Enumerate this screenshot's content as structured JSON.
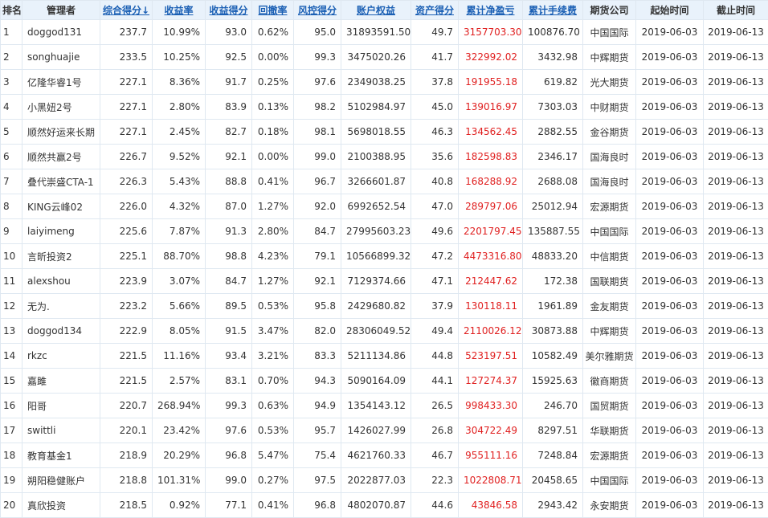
{
  "columns": [
    {
      "label": "排名",
      "sortable": false,
      "sorted": false
    },
    {
      "label": "管理者",
      "sortable": false,
      "sorted": false
    },
    {
      "label": "综合得分↓",
      "sortable": true,
      "sorted": true
    },
    {
      "label": "收益率",
      "sortable": true,
      "sorted": false
    },
    {
      "label": "收益得分",
      "sortable": true,
      "sorted": false
    },
    {
      "label": "回撤率",
      "sortable": true,
      "sorted": false
    },
    {
      "label": "风控得分",
      "sortable": true,
      "sorted": false
    },
    {
      "label": "账户权益",
      "sortable": true,
      "sorted": false
    },
    {
      "label": "资产得分",
      "sortable": true,
      "sorted": false
    },
    {
      "label": "累计净盈亏",
      "sortable": true,
      "sorted": false
    },
    {
      "label": "累计手续费",
      "sortable": true,
      "sorted": false
    },
    {
      "label": "期货公司",
      "sortable": false,
      "sorted": false
    },
    {
      "label": "起始时间",
      "sortable": false,
      "sorted": false
    },
    {
      "label": "截止时间",
      "sortable": false,
      "sorted": false
    }
  ],
  "rows": [
    [
      "1",
      "doggod131",
      "237.7",
      "10.99%",
      "93.0",
      "0.62%",
      "95.0",
      "31893591.50",
      "49.7",
      "3157703.30",
      "100876.70",
      "中国国际",
      "2019-06-03",
      "2019-06-13"
    ],
    [
      "2",
      "songhuajie",
      "233.5",
      "10.25%",
      "92.5",
      "0.00%",
      "99.3",
      "3475020.26",
      "41.7",
      "322992.02",
      "3432.98",
      "中辉期货",
      "2019-06-03",
      "2019-06-13"
    ],
    [
      "3",
      "亿隆华睿1号",
      "227.1",
      "8.36%",
      "91.7",
      "0.25%",
      "97.6",
      "2349038.25",
      "37.8",
      "191955.18",
      "619.82",
      "光大期货",
      "2019-06-03",
      "2019-06-13"
    ],
    [
      "4",
      "小黑妞2号",
      "227.1",
      "2.80%",
      "83.9",
      "0.13%",
      "98.2",
      "5102984.97",
      "45.0",
      "139016.97",
      "7303.03",
      "中财期货",
      "2019-06-03",
      "2019-06-13"
    ],
    [
      "5",
      "顺然好运来长期",
      "227.1",
      "2.45%",
      "82.7",
      "0.18%",
      "98.1",
      "5698018.55",
      "46.3",
      "134562.45",
      "2882.55",
      "金谷期货",
      "2019-06-03",
      "2019-06-13"
    ],
    [
      "6",
      "顺然共赢2号",
      "226.7",
      "9.52%",
      "92.1",
      "0.00%",
      "99.0",
      "2100388.95",
      "35.6",
      "182598.83",
      "2346.17",
      "国海良时",
      "2019-06-03",
      "2019-06-13"
    ],
    [
      "7",
      "叠代崇盛CTA-1",
      "226.3",
      "5.43%",
      "88.8",
      "0.41%",
      "96.7",
      "3266601.87",
      "40.8",
      "168288.92",
      "2688.08",
      "国海良时",
      "2019-06-03",
      "2019-06-13"
    ],
    [
      "8",
      "KING云峰02",
      "226.0",
      "4.32%",
      "87.0",
      "1.27%",
      "92.0",
      "6992652.54",
      "47.0",
      "289797.06",
      "25012.94",
      "宏源期货",
      "2019-06-03",
      "2019-06-13"
    ],
    [
      "9",
      "laiyimeng",
      "225.6",
      "7.87%",
      "91.3",
      "2.80%",
      "84.7",
      "27995603.23",
      "49.6",
      "2201797.45",
      "135887.55",
      "中国国际",
      "2019-06-03",
      "2019-06-13"
    ],
    [
      "10",
      "言昕投资2",
      "225.1",
      "88.70%",
      "98.8",
      "4.23%",
      "79.1",
      "10566899.32",
      "47.2",
      "4473316.80",
      "48833.20",
      "中信期货",
      "2019-06-03",
      "2019-06-13"
    ],
    [
      "11",
      "alexshou",
      "223.9",
      "3.07%",
      "84.7",
      "1.27%",
      "92.1",
      "7129374.66",
      "47.1",
      "212447.62",
      "172.38",
      "国联期货",
      "2019-06-03",
      "2019-06-13"
    ],
    [
      "12",
      "无为.",
      "223.2",
      "5.66%",
      "89.5",
      "0.53%",
      "95.8",
      "2429680.82",
      "37.9",
      "130118.11",
      "1961.89",
      "金友期货",
      "2019-06-03",
      "2019-06-13"
    ],
    [
      "13",
      "doggod134",
      "222.9",
      "8.05%",
      "91.5",
      "3.47%",
      "82.0",
      "28306049.52",
      "49.4",
      "2110026.12",
      "30873.88",
      "中辉期货",
      "2019-06-03",
      "2019-06-13"
    ],
    [
      "14",
      "rkzc",
      "221.5",
      "11.16%",
      "93.4",
      "3.21%",
      "83.3",
      "5211134.86",
      "44.8",
      "523197.51",
      "10582.49",
      "美尔雅期货",
      "2019-06-03",
      "2019-06-13"
    ],
    [
      "15",
      "嘉雎",
      "221.5",
      "2.57%",
      "83.1",
      "0.70%",
      "94.3",
      "5090164.09",
      "44.1",
      "127274.37",
      "15925.63",
      "徽商期货",
      "2019-06-03",
      "2019-06-13"
    ],
    [
      "16",
      "阳哥",
      "220.7",
      "268.94%",
      "99.3",
      "0.63%",
      "94.9",
      "1354143.12",
      "26.5",
      "998433.30",
      "246.70",
      "国贸期货",
      "2019-06-03",
      "2019-06-13"
    ],
    [
      "17",
      "swittli",
      "220.1",
      "23.42%",
      "97.6",
      "0.53%",
      "95.7",
      "1426027.99",
      "26.8",
      "304722.49",
      "8297.51",
      "华联期货",
      "2019-06-03",
      "2019-06-13"
    ],
    [
      "18",
      "教育基金1",
      "218.9",
      "20.29%",
      "96.8",
      "5.47%",
      "75.4",
      "4621760.33",
      "46.7",
      "955111.16",
      "7248.84",
      "宏源期货",
      "2019-06-03",
      "2019-06-13"
    ],
    [
      "19",
      "朔阳稳健账户",
      "218.8",
      "101.31%",
      "99.0",
      "0.27%",
      "97.5",
      "2022877.03",
      "22.3",
      "1022808.71",
      "20458.65",
      "中国国际",
      "2019-06-03",
      "2019-06-13"
    ],
    [
      "20",
      "真欣投资",
      "218.5",
      "0.92%",
      "77.1",
      "0.41%",
      "96.8",
      "4802070.87",
      "44.6",
      "43846.58",
      "2943.42",
      "永安期货",
      "2019-06-03",
      "2019-06-13"
    ]
  ],
  "colors": {
    "header_bg": "#e9f2fb",
    "link": "#1a5fb4",
    "profit_red": "#e02020",
    "border": "#dfe8f1"
  }
}
